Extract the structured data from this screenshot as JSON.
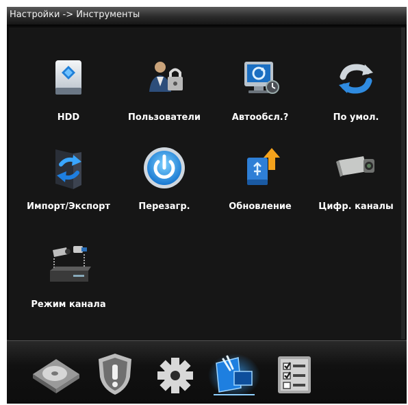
{
  "window": {
    "title": "Настройки -> Инструменты"
  },
  "tools": [
    {
      "label": "HDD",
      "icon": "hdd-icon"
    },
    {
      "label": "Пользователи",
      "icon": "users-lock-icon"
    },
    {
      "label": "Автообсл.?",
      "icon": "auto-maintenance-icon"
    },
    {
      "label": "По умол.",
      "icon": "restore-defaults-icon"
    },
    {
      "label": "Импорт/Экспорт",
      "icon": "import-export-icon"
    },
    {
      "label": "Перезагр.",
      "icon": "restart-icon"
    },
    {
      "label": "Обновление",
      "icon": "upgrade-icon"
    },
    {
      "label": "Цифр. каналы",
      "icon": "digital-camera-icon"
    },
    {
      "label": "Режим канала",
      "icon": "channel-mode-icon"
    }
  ],
  "taskbar": {
    "buttons": [
      {
        "name": "storage-button",
        "icon": "disk-icon",
        "active": false
      },
      {
        "name": "alarm-button",
        "icon": "shield-warning-icon",
        "active": false
      },
      {
        "name": "system-button",
        "icon": "gear-icon",
        "active": false
      },
      {
        "name": "tools-button",
        "icon": "tools-icon",
        "active": true
      },
      {
        "name": "info-button",
        "icon": "checklist-icon",
        "active": false
      }
    ]
  },
  "colors": {
    "background": "#161616",
    "text": "#ffffff",
    "accent": "#1e7fe0"
  }
}
